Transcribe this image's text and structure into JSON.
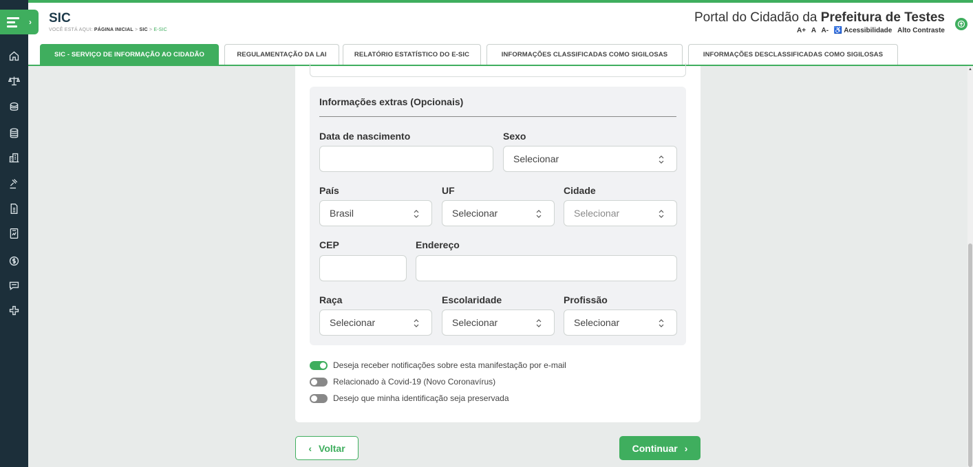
{
  "header": {
    "title": "SIC",
    "breadcrumb_prefix": "VOCÊ ESTÁ AQUI:",
    "breadcrumb": [
      "PÁGINA INICIAL",
      "SIC",
      "E-SIC"
    ],
    "breadcrumb_sep": ">",
    "portal_prefix": "Portal do Cidadão da",
    "portal_name": "Prefeitura de Testes",
    "font_increase": "A+",
    "font_normal": "A",
    "font_decrease": "A-",
    "accessibility": "Acessibilidade",
    "high_contrast": "Alto Contraste"
  },
  "tabs": [
    "SIC - SERVIÇO DE INFORMAÇÃO AO CIDADÃO",
    "REGULAMENTAÇÃO DA LAI",
    "RELATÓRIO ESTATÍSTICO DO E-SIC",
    "INFORMAÇÕES CLASSIFICADAS COMO SIGILOSAS",
    "INFORMAÇÕES DESCLASSIFICADAS COMO SIGILOSAS"
  ],
  "sidebar_icons": [
    "home-icon",
    "scale-icon",
    "coins-icon",
    "coins-stack-icon",
    "building-icon",
    "gavel-icon",
    "document-icon",
    "report-icon",
    "money-icon",
    "chat-icon",
    "health-cross-icon"
  ],
  "extras": {
    "title": "Informações extras (Opcionais)",
    "birth_label": "Data de nascimento",
    "birth_value": "",
    "sex_label": "Sexo",
    "sex_value": "Selecionar",
    "country_label": "País",
    "country_value": "Brasil",
    "uf_label": "UF",
    "uf_value": "Selecionar",
    "city_label": "Cidade",
    "city_value": "Selecionar",
    "cep_label": "CEP",
    "cep_value": "",
    "address_label": "Endereço",
    "address_value": "",
    "race_label": "Raça",
    "race_value": "Selecionar",
    "education_label": "Escolaridade",
    "education_value": "Selecionar",
    "profession_label": "Profissão",
    "profession_value": "Selecionar"
  },
  "toggles": [
    {
      "label": "Deseja receber notificações sobre esta manifestação por e-mail",
      "on": true
    },
    {
      "label": "Relacionado à Covid-19 (Novo Coronavírus)",
      "on": false
    },
    {
      "label": "Desejo que minha identificação seja preservada",
      "on": false
    }
  ],
  "buttons": {
    "back": "Voltar",
    "next": "Continuar"
  },
  "colors": {
    "accent": "#3fae5e",
    "sidebar": "#1c2f3a",
    "background": "#e8ebea"
  }
}
